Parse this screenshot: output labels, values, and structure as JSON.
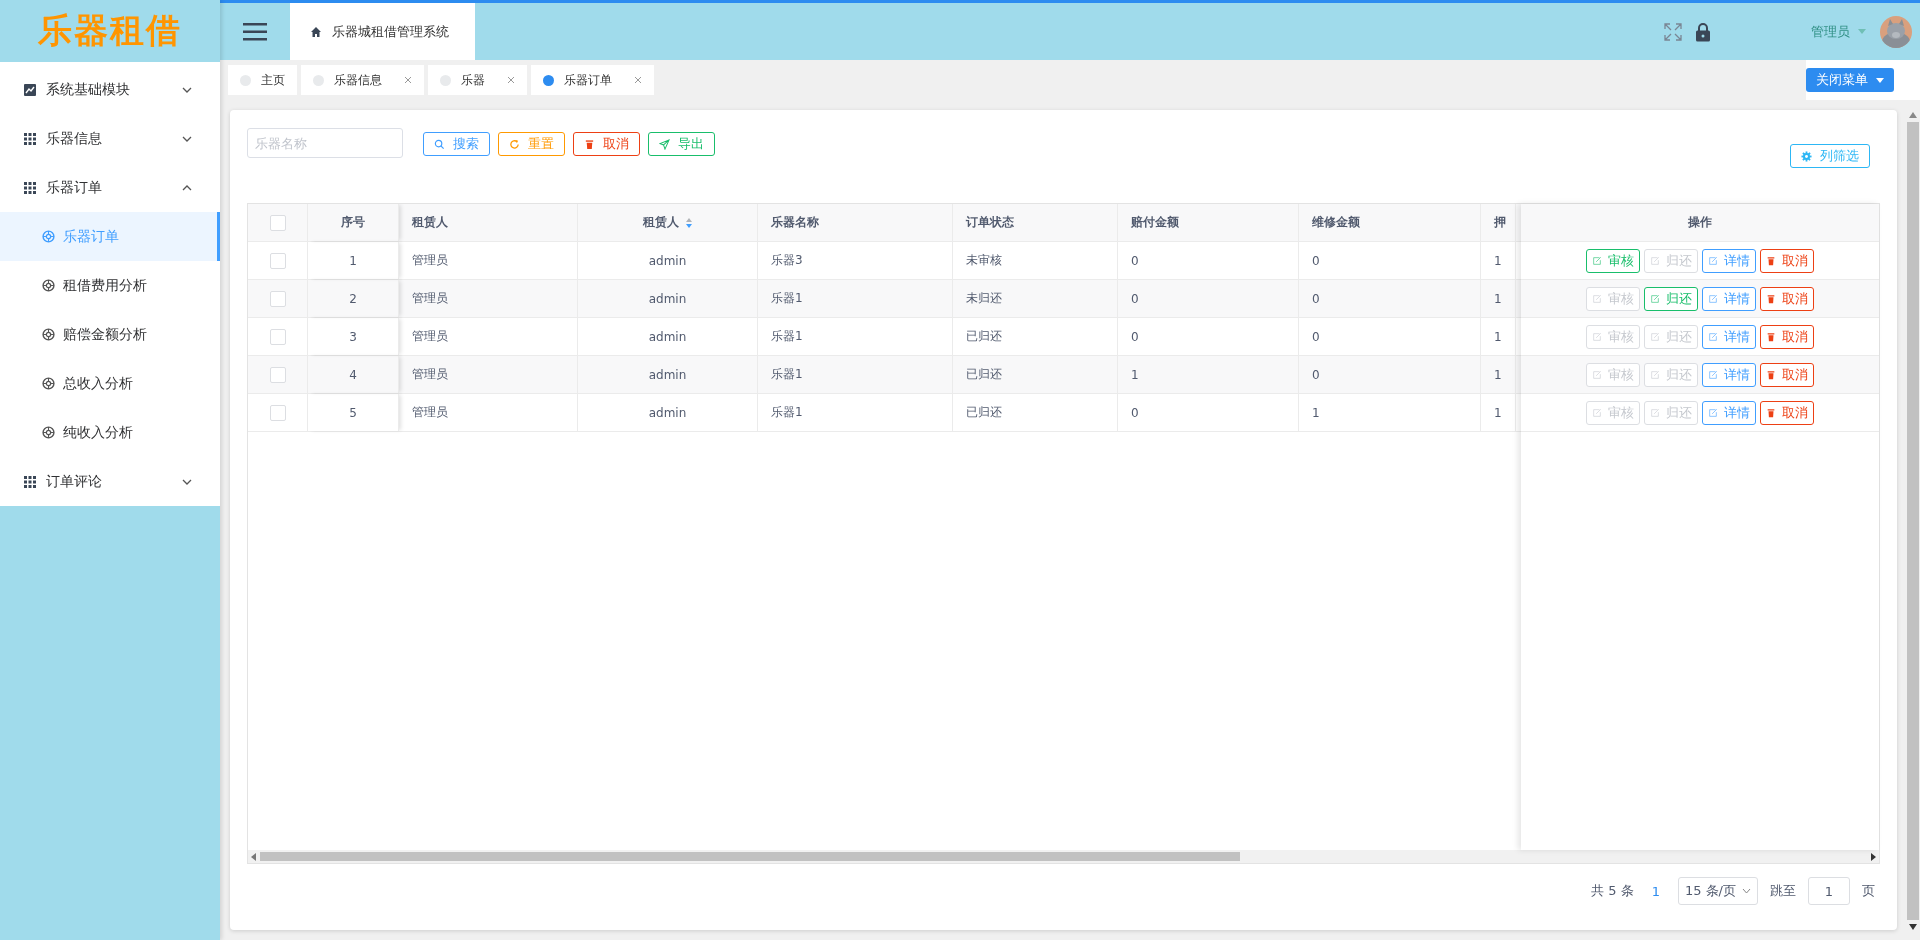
{
  "logo": {
    "text": "乐器租借"
  },
  "header": {
    "breadcrumb": "乐器城租借管理系统",
    "user": "管理员"
  },
  "sidebar": {
    "items": [
      {
        "label": "系统基础模块",
        "expanded": false
      },
      {
        "label": "乐器信息",
        "expanded": false
      },
      {
        "label": "乐器订单",
        "expanded": true,
        "children": [
          {
            "label": "乐器订单",
            "selected": true
          },
          {
            "label": "租借费用分析",
            "selected": false
          },
          {
            "label": "赔偿金额分析",
            "selected": false
          },
          {
            "label": "总收入分析",
            "selected": false
          },
          {
            "label": "纯收入分析",
            "selected": false
          }
        ]
      },
      {
        "label": "订单评论",
        "expanded": false
      }
    ]
  },
  "tabs": [
    {
      "label": "主页",
      "selected": false,
      "closable": false
    },
    {
      "label": "乐器信息",
      "selected": false,
      "closable": true
    },
    {
      "label": "乐器",
      "selected": false,
      "closable": true
    },
    {
      "label": "乐器订单",
      "selected": true,
      "closable": true
    }
  ],
  "close_menu": "关闭菜单",
  "search": {
    "placeholder": "乐器名称"
  },
  "toolbar": [
    {
      "kind": "search",
      "label": "搜索"
    },
    {
      "kind": "reset",
      "label": "重置"
    },
    {
      "kind": "cancel",
      "label": "取消"
    },
    {
      "kind": "export",
      "label": "导出"
    }
  ],
  "column_filter": "列筛选",
  "table": {
    "select_all": false,
    "columns": [
      {
        "label": "序号",
        "sortable": false
      },
      {
        "label": "租赁人",
        "sortable": false
      },
      {
        "label": "租赁人",
        "sortable": true
      },
      {
        "label": "乐器名称",
        "sortable": false
      },
      {
        "label": "订单状态",
        "sortable": false
      },
      {
        "label": "赔付金额",
        "sortable": false
      },
      {
        "label": "维修金额",
        "sortable": false
      },
      {
        "label": "押"
      },
      {
        "label": "操作"
      }
    ],
    "rows": [
      {
        "checked": false,
        "cells": [
          "1",
          "管理员",
          "admin",
          "乐器3",
          "未审核",
          "0",
          "0",
          "1"
        ],
        "actions": [
          {
            "kind": "audit",
            "label": "审核",
            "disabled": false
          },
          {
            "kind": "return",
            "label": "归还",
            "disabled": true
          },
          {
            "kind": "detail",
            "label": "详情",
            "disabled": false
          },
          {
            "kind": "cancel",
            "label": "取消",
            "disabled": false
          }
        ]
      },
      {
        "checked": false,
        "cells": [
          "2",
          "管理员",
          "admin",
          "乐器1",
          "未归还",
          "0",
          "0",
          "1"
        ],
        "actions": [
          {
            "kind": "audit",
            "label": "审核",
            "disabled": true
          },
          {
            "kind": "return",
            "label": "归还",
            "disabled": false
          },
          {
            "kind": "detail",
            "label": "详情",
            "disabled": false
          },
          {
            "kind": "cancel",
            "label": "取消",
            "disabled": false
          }
        ]
      },
      {
        "checked": false,
        "cells": [
          "3",
          "管理员",
          "admin",
          "乐器1",
          "已归还",
          "0",
          "0",
          "1"
        ],
        "actions": [
          {
            "kind": "audit",
            "label": "审核",
            "disabled": true
          },
          {
            "kind": "return",
            "label": "归还",
            "disabled": true
          },
          {
            "kind": "detail",
            "label": "详情",
            "disabled": false
          },
          {
            "kind": "cancel",
            "label": "取消",
            "disabled": false
          }
        ]
      },
      {
        "checked": false,
        "cells": [
          "4",
          "管理员",
          "admin",
          "乐器1",
          "已归还",
          "1",
          "0",
          "1"
        ],
        "actions": [
          {
            "kind": "audit",
            "label": "审核",
            "disabled": true
          },
          {
            "kind": "return",
            "label": "归还",
            "disabled": true
          },
          {
            "kind": "detail",
            "label": "详情",
            "disabled": false
          },
          {
            "kind": "cancel",
            "label": "取消",
            "disabled": false
          }
        ]
      },
      {
        "checked": false,
        "cells": [
          "5",
          "管理员",
          "admin",
          "乐器1",
          "已归还",
          "0",
          "1",
          "1"
        ],
        "actions": [
          {
            "kind": "audit",
            "label": "审核",
            "disabled": true
          },
          {
            "kind": "return",
            "label": "归还",
            "disabled": true
          },
          {
            "kind": "detail",
            "label": "详情",
            "disabled": false
          },
          {
            "kind": "cancel",
            "label": "取消",
            "disabled": false
          }
        ]
      }
    ]
  },
  "pagination": {
    "total": "共 5 条",
    "pages": [
      {
        "label": "1",
        "selected": true
      }
    ],
    "page_size": "15 条/页",
    "jump_label": "跳至",
    "jump_value": "1",
    "page_unit": "页"
  }
}
